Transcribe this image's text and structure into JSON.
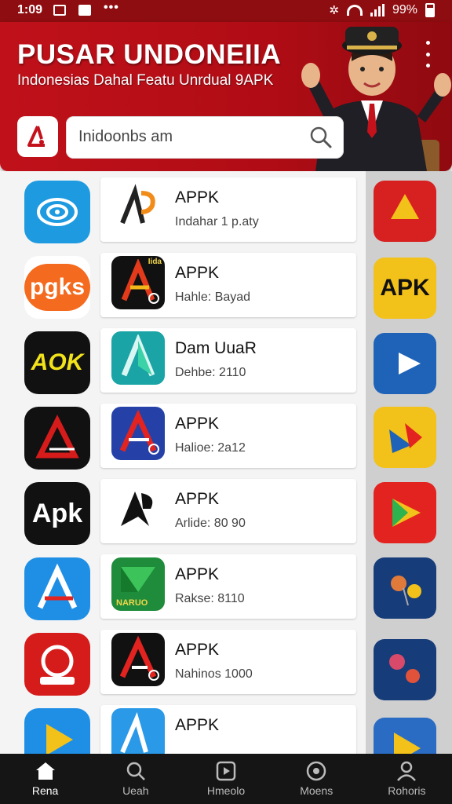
{
  "status_bar": {
    "time": "1:09",
    "dots": "•••",
    "battery": "99%",
    "icons": [
      "image-icon",
      "mail-icon",
      "wifi-icon",
      "signal-icon",
      "battery-icon"
    ]
  },
  "header": {
    "title": "PUSAR UNDONEIIA",
    "subtitle": "Indonesias Dahal Featu Unrdual 9APK",
    "menu_icon": "kebab-menu-icon",
    "colors": {
      "banner": "#c0111a",
      "dark_red": "#8e0d10"
    }
  },
  "search": {
    "value": "Inidoonbs am",
    "icon": "search-icon"
  },
  "apps": [
    {
      "name": "APPK",
      "meta": "Indahar 1 p.aty"
    },
    {
      "name": "APPK",
      "meta": "Hahle: Bayad"
    },
    {
      "name": "Dam UuaR",
      "meta": "Dehbe: 2110"
    },
    {
      "name": "APPK",
      "meta": "Halioe: 2a12"
    },
    {
      "name": "APPK",
      "meta": "Arlide: 80 90"
    },
    {
      "name": "APPK",
      "meta": "Rakse: 8110"
    },
    {
      "name": "APPK",
      "meta": "Nahinos 1000"
    },
    {
      "name": "APPK",
      "meta": ""
    }
  ],
  "left_icons": [
    {
      "text": "",
      "bg": "#1e9be0"
    },
    {
      "text": "pgks",
      "bg": "#ffffff"
    },
    {
      "text": "AOK",
      "bg": "#111111"
    },
    {
      "text": "",
      "bg": "#111111"
    },
    {
      "text": "Apk",
      "bg": "#111111"
    },
    {
      "text": "",
      "bg": "#1f8fe6"
    },
    {
      "text": "",
      "bg": "#d61b1b"
    },
    {
      "text": "",
      "bg": "#1f8fe6"
    }
  ],
  "mid_icon_texts": {
    "row2_badge": "Iida",
    "row6_label": "NARUO"
  },
  "right_icons": [
    {
      "text": "",
      "bg": "#d72020"
    },
    {
      "text": "APK",
      "bg": "#f2c11a"
    },
    {
      "text": "",
      "bg": "#1e63b8"
    },
    {
      "text": "",
      "bg": "#f2c11a"
    },
    {
      "text": "",
      "bg": "#e3231f"
    },
    {
      "text": "",
      "bg": "#173c7a"
    },
    {
      "text": "",
      "bg": "#173c7a"
    },
    {
      "text": "",
      "bg": "#2a6cc3"
    }
  ],
  "bottom_nav": [
    {
      "label": "Rena",
      "icon": "home-icon",
      "active": true
    },
    {
      "label": "Ueah",
      "icon": "search-icon",
      "active": false
    },
    {
      "label": "Hmeolo",
      "icon": "video-icon",
      "active": false
    },
    {
      "label": "Moens",
      "icon": "compass-icon",
      "active": false
    },
    {
      "label": "Rohoris",
      "icon": "profile-icon",
      "active": false
    }
  ]
}
